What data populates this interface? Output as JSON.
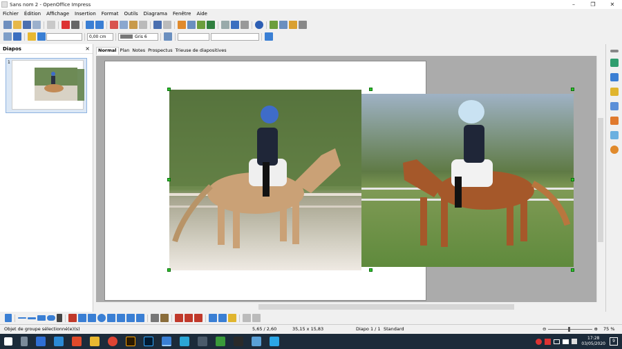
{
  "window": {
    "title": "Sans nom 2 - OpenOffice Impress",
    "minimize": "–",
    "maximize": "❐",
    "close": "✕"
  },
  "menu": [
    "Fichier",
    "Édition",
    "Affichage",
    "Insertion",
    "Format",
    "Outils",
    "Diagrama",
    "Fenêtre",
    "Aide"
  ],
  "toolbar2": {
    "position_field": "",
    "line_width": "0,00 cm",
    "line_color": "Gris 6",
    "area_field": ""
  },
  "slides_panel": {
    "title": "Diapos",
    "close": "×",
    "slide_number": "1"
  },
  "view_tabs": [
    "Normal",
    "Plan",
    "Notes",
    "Prospectus",
    "Trieuse de diapositives"
  ],
  "status": {
    "selection": "Objet de groupe sélectionné(e)(s)",
    "position": "5,65 / 2,60",
    "size": "35,15 x 15,83",
    "slide": "Diapo 1 / 1",
    "layout": "Standard",
    "zoom": "75 %"
  },
  "taskbar": {
    "time": "17:28",
    "date": "03/05/2020",
    "notifications": "9"
  },
  "colors": {
    "selection_handle": "#2fc32f",
    "canvas_bg": "#ababab",
    "taskbar_bg": "#1c2b3a",
    "avatar_left": "#3f6cc9",
    "avatar_right": "#c9e2f2"
  }
}
